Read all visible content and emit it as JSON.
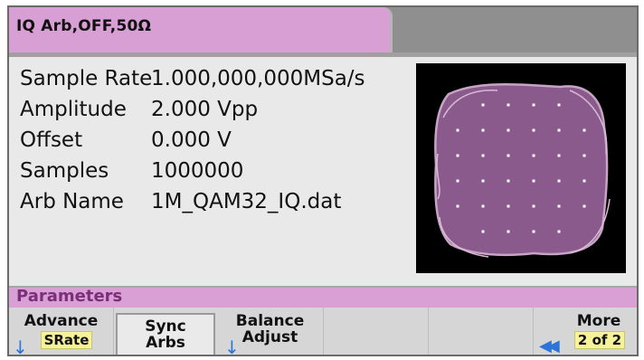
{
  "tab": {
    "title": "IQ Arb,OFF,50Ω"
  },
  "parameters": [
    {
      "label": "Sample Rate",
      "value": "1.000,000,000MSa/s"
    },
    {
      "label": "Amplitude",
      "value": "2.000 Vpp"
    },
    {
      "label": "Offset",
      "value": "0.000 V"
    },
    {
      "label": "Samples",
      "value": "1000000"
    },
    {
      "label": "Arb Name",
      "value": "1M_QAM32_IQ.dat"
    }
  ],
  "section_title": "Parameters",
  "softkeys": {
    "advance": {
      "label": "Advance",
      "value": "SRate"
    },
    "sync_arbs": {
      "line1": "Sync",
      "line2": "Arbs"
    },
    "balance_adjust": {
      "line1": "Balance",
      "line2": "Adjust"
    },
    "more": {
      "label": "More",
      "value": "2 of 2"
    }
  },
  "icons": {
    "down_arrow": "arrow-down-icon",
    "double_left": "double-chevron-left-icon"
  },
  "colors": {
    "tab": "#d89fd4",
    "parameter_bar": "#d8a0d4",
    "parameter_text": "#7b2f78",
    "highlight": "#f5f29a",
    "constellation": "#a070a0"
  }
}
